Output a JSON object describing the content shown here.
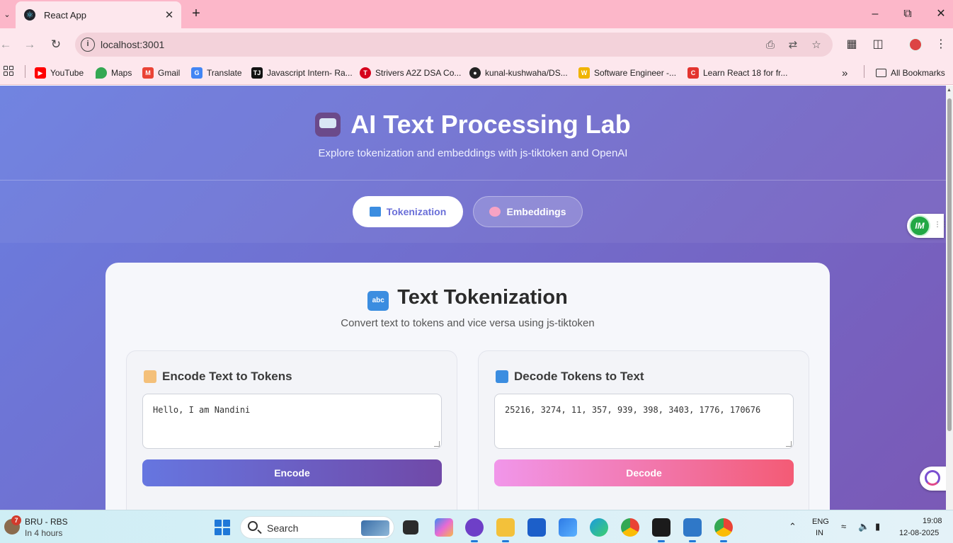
{
  "browser": {
    "tab_title": "React App",
    "url": "localhost:3001",
    "bookmarks": [
      {
        "label": "YouTube",
        "color": "#ff0000"
      },
      {
        "label": "Maps",
        "color": "#34a853"
      },
      {
        "label": "Gmail",
        "color": "#ea4335"
      },
      {
        "label": "Translate",
        "color": "#4285f4"
      },
      {
        "label": "Javascript Intern- Ra...",
        "color": "#111111"
      },
      {
        "label": "Strivers A2Z DSA Co...",
        "color": "#d6001c"
      },
      {
        "label": "kunal-kushwaha/DS...",
        "color": "#222222"
      },
      {
        "label": "Software Engineer -...",
        "color": "#f0b400"
      },
      {
        "label": "Learn React 18 for fr...",
        "color": "#e3342f"
      }
    ],
    "all_bookmarks": "All Bookmarks"
  },
  "app": {
    "title": "AI Text Processing Lab",
    "subtitle": "Explore tokenization and embeddings with js-tiktoken and OpenAI",
    "tabs": [
      {
        "label": "Tokenization",
        "active": true
      },
      {
        "label": "Embeddings",
        "active": false
      }
    ]
  },
  "section": {
    "title": "Text Tokenization",
    "subtitle": "Convert text to tokens and vice versa using js-tiktoken",
    "abc_icon_text": "abc",
    "encode": {
      "heading": "Encode Text to Tokens",
      "input_value": "Hello, I am Nandini",
      "button": "Encode"
    },
    "decode": {
      "heading": "Decode Tokens to Text",
      "input_value": "25216, 3274, 11, 357, 939, 398, 3403, 1776, 170676",
      "button": "Decode"
    }
  },
  "widgets": {
    "ext_initials": "IM"
  },
  "taskbar": {
    "weather_badge": "7",
    "weather_line1": "BRU - RBS",
    "weather_line2": "In 4 hours",
    "search_label": "Search",
    "lang_line1": "ENG",
    "lang_line2": "IN",
    "time": "19:08",
    "date": "12-08-2025"
  }
}
